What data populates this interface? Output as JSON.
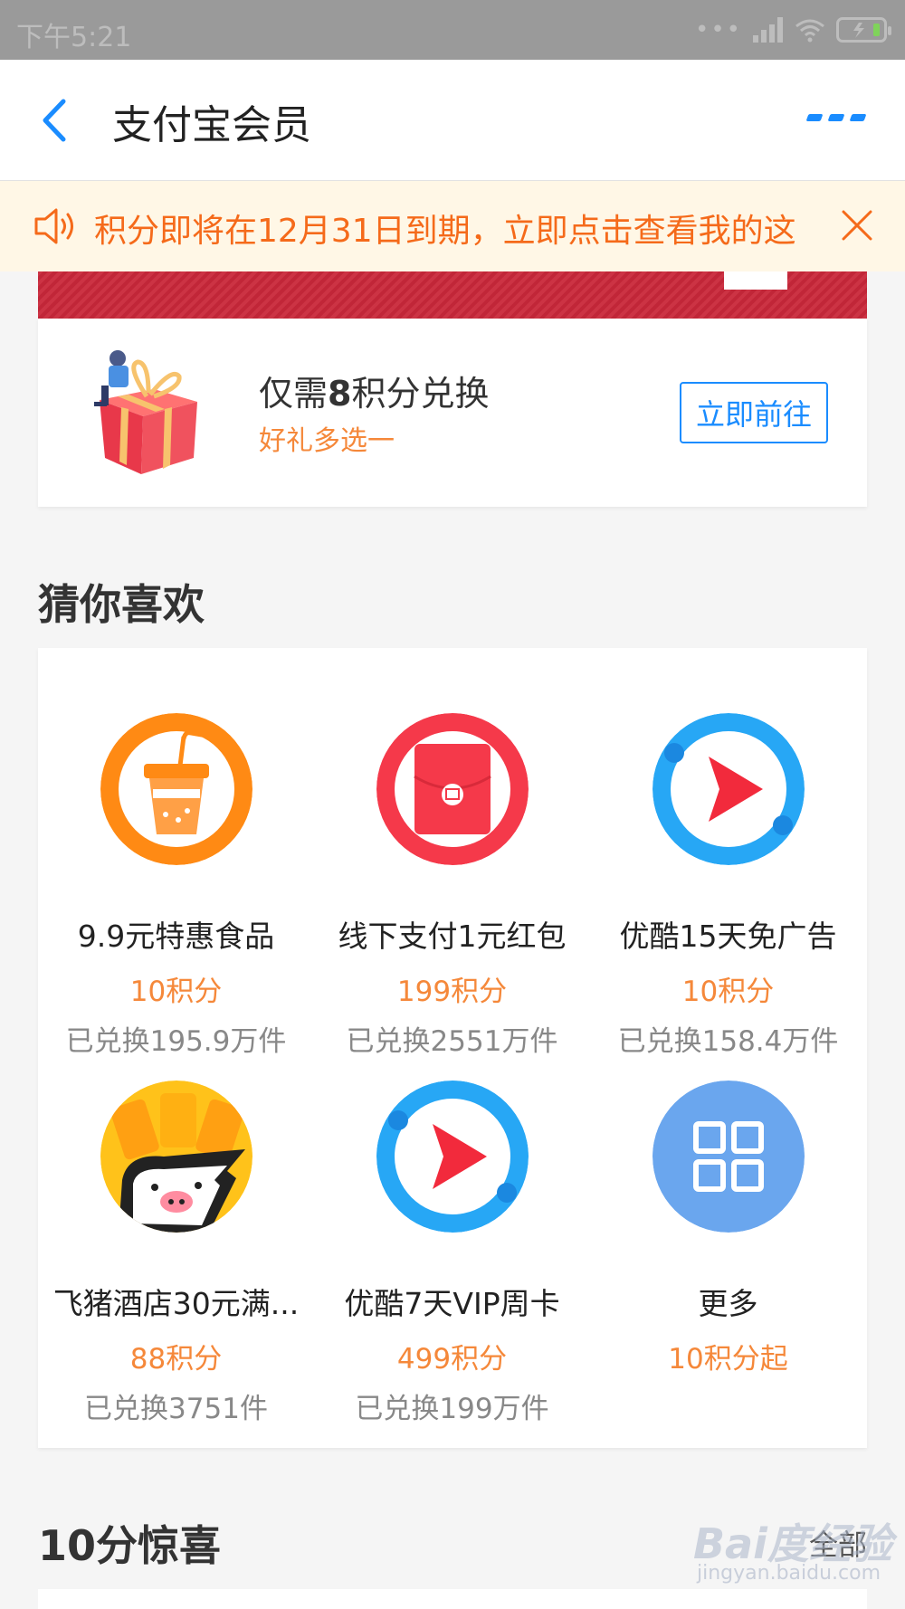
{
  "status_bar": {
    "time": "下午5:21",
    "dots": "•••"
  },
  "nav": {
    "title": "支付宝会员"
  },
  "notice": {
    "text": "积分即将在12月31日到期，立即点击查看我的这"
  },
  "promo": {
    "title_prefix": "仅需",
    "title_points": "8",
    "title_suffix": "积分兑换",
    "subtitle": "好礼多选一",
    "button_label": "立即前往"
  },
  "guess": {
    "title": "猜你喜欢",
    "items": [
      {
        "name": "9.9元特惠食品",
        "price": "10积分",
        "count": "已兑换195.9万件",
        "icon": "bubble-tea-icon"
      },
      {
        "name": "线下支付1元红包",
        "price": "199积分",
        "count": "已兑换2551万件",
        "icon": "red-envelope-icon"
      },
      {
        "name": "优酷15天免广告",
        "price": "10积分",
        "count": "已兑换158.4万件",
        "icon": "youku-play-icon"
      },
      {
        "name": "飞猪酒店30元满...",
        "price": "88积分",
        "count": "已兑换3751件",
        "icon": "fliggy-pig-icon"
      },
      {
        "name": "优酷7天VIP周卡",
        "price": "499积分",
        "count": "已兑换199万件",
        "icon": "youku-play-icon"
      },
      {
        "name": "更多",
        "price": "10积分起",
        "count": "",
        "icon": "grid-icon"
      }
    ]
  },
  "surprise": {
    "title": "10分惊喜",
    "all_label": "全部"
  },
  "watermark": {
    "text": "Bai度经验",
    "sub": "jingyan.baidu.com"
  },
  "colors": {
    "accent_blue": "#1a8cff",
    "orange": "#f5883a",
    "notice_bg": "#fff7e6",
    "notice_text": "#f56a1a"
  }
}
